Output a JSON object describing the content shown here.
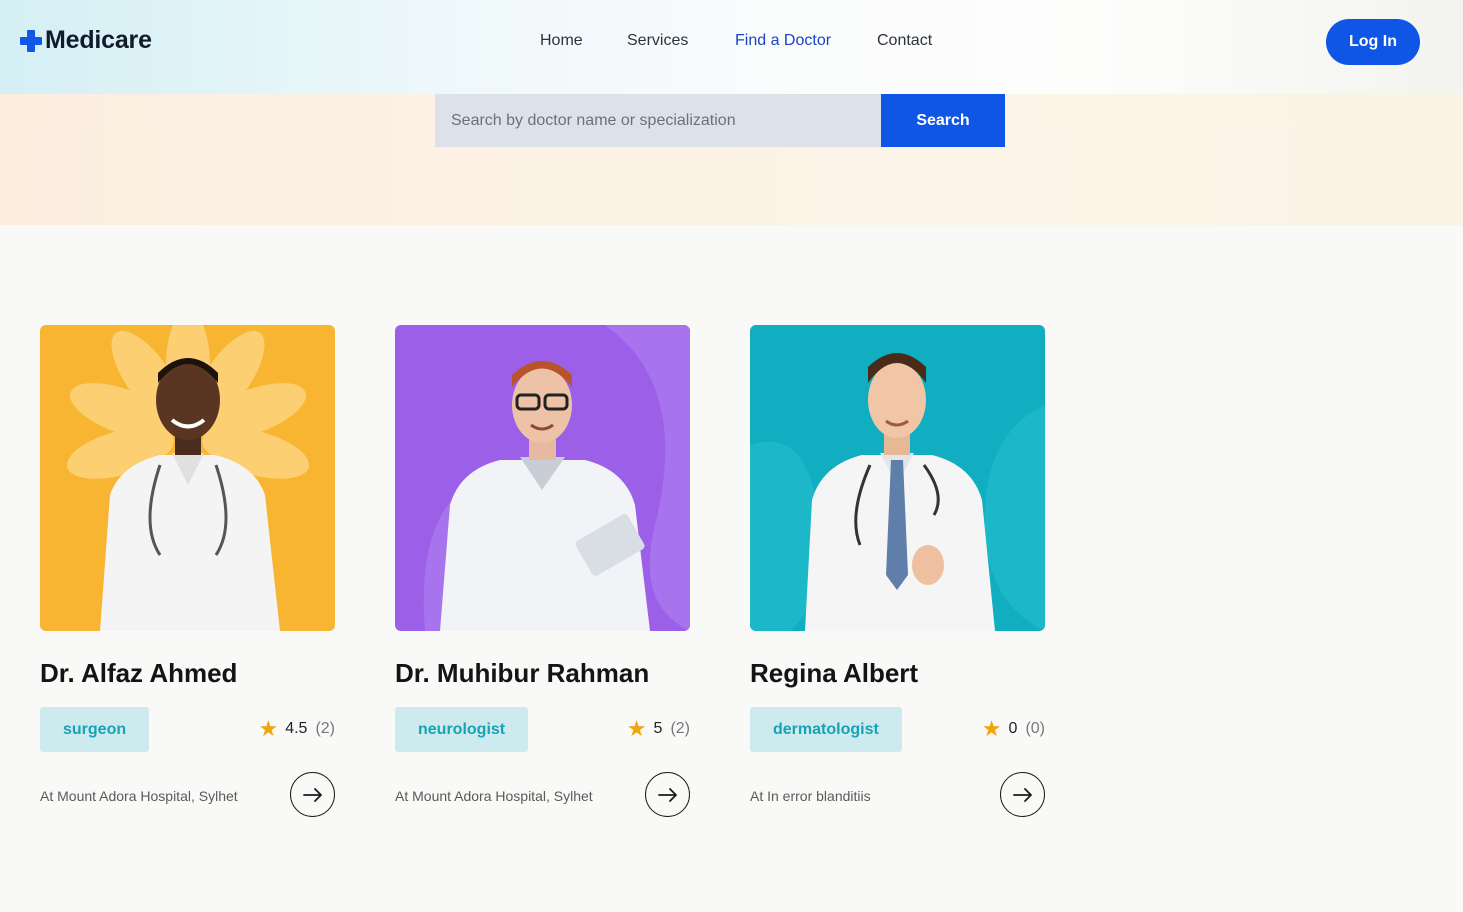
{
  "header": {
    "logo_text": "Medicare",
    "nav": [
      {
        "label": "Home",
        "active": false
      },
      {
        "label": "Services",
        "active": false
      },
      {
        "label": "Find a Doctor",
        "active": true
      },
      {
        "label": "Contact",
        "active": false
      }
    ],
    "login_label": "Log In"
  },
  "search": {
    "placeholder": "Search by doctor name or specialization",
    "button_label": "Search"
  },
  "colors": {
    "accent": "#0f56e6",
    "badge_bg": "#cdeaee",
    "badge_text": "#17a3b3",
    "star": "#f2a50b"
  },
  "doctors": [
    {
      "name": "Dr. Alfaz Ahmed",
      "specialization": "surgeon",
      "rating": "4.5",
      "reviews": "(2)",
      "hospital": "At Mount Adora Hospital, Sylhet",
      "photo_bg": "#f7b531"
    },
    {
      "name": "Dr. Muhibur Rahman",
      "specialization": "neurologist",
      "rating": "5",
      "reviews": "(2)",
      "hospital": "At Mount Adora Hospital, Sylhet",
      "photo_bg": "#9b5fe8"
    },
    {
      "name": "Regina Albert",
      "specialization": "dermatologist",
      "rating": "0",
      "reviews": "(0)",
      "hospital": "At In error blanditiis",
      "photo_bg": "#10aec0"
    }
  ]
}
